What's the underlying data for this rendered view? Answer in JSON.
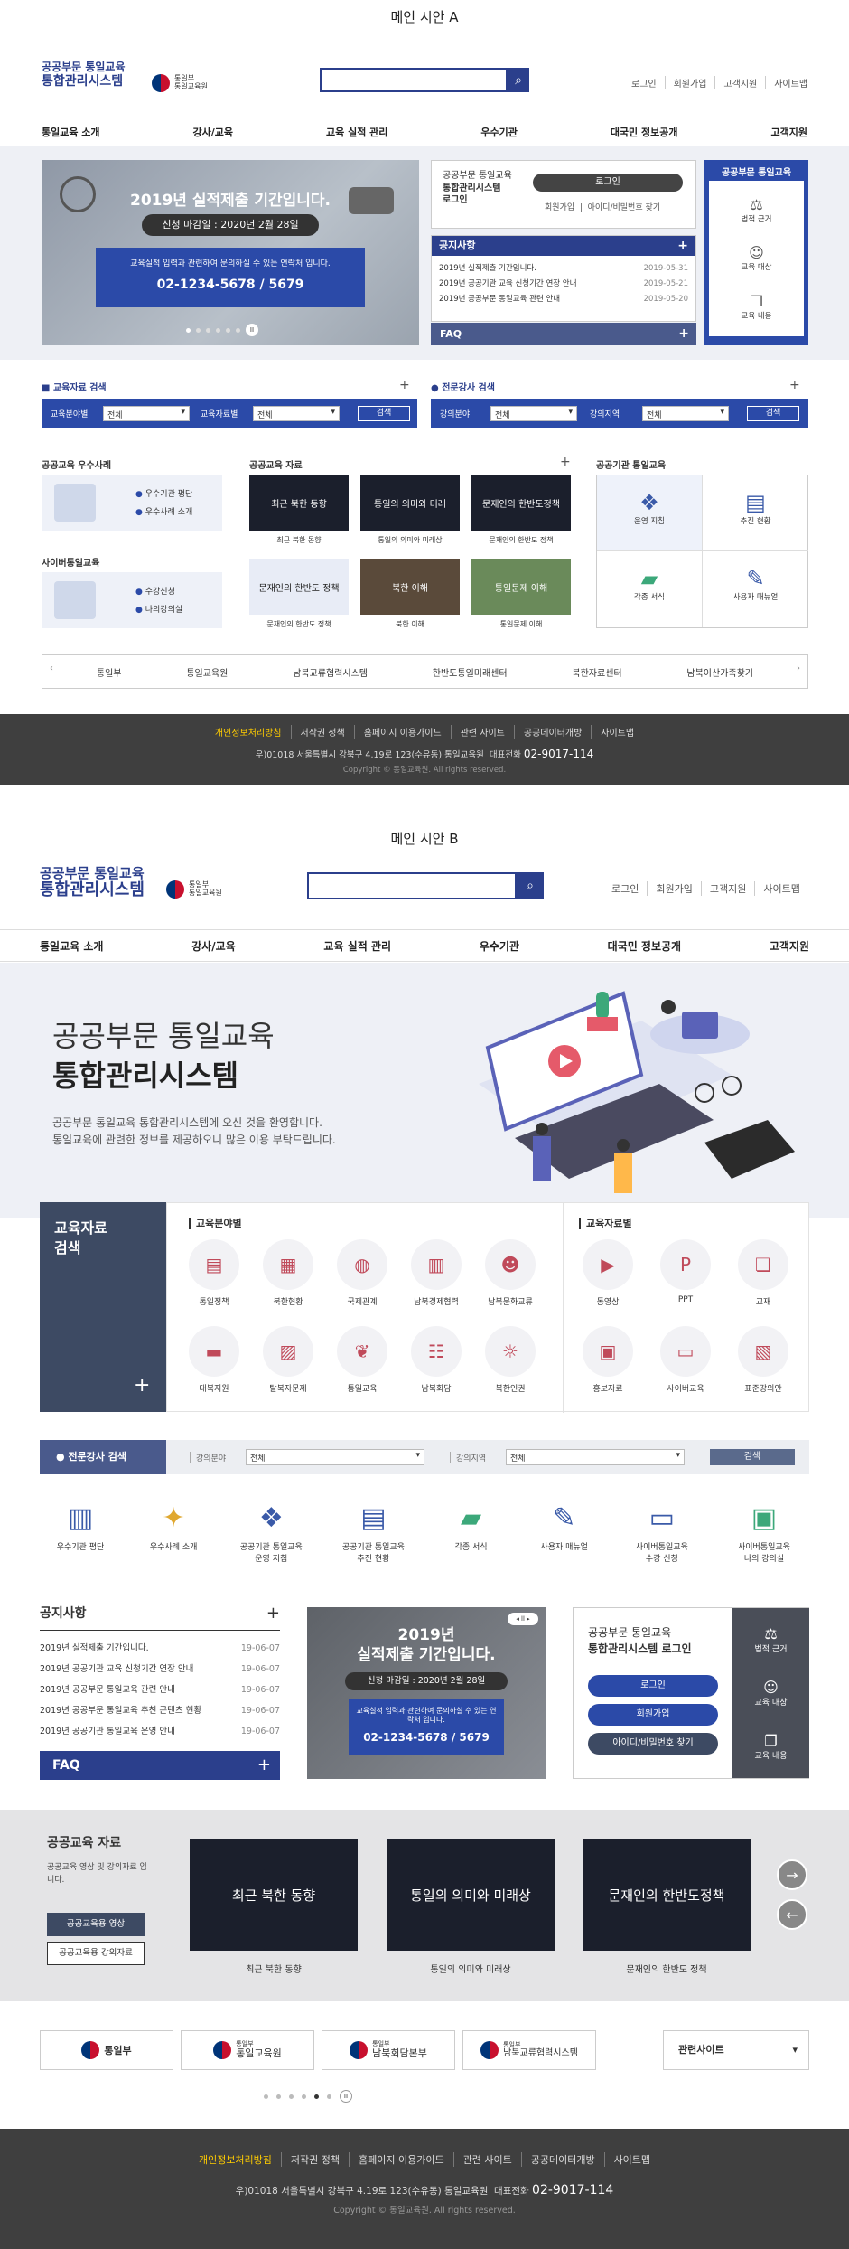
{
  "a": {
    "section_title": "메인 시안 A",
    "logo": {
      "line1": "공공부문 통일교육",
      "line2": "통합관리시스템"
    },
    "uni_logo": {
      "line1": "통일부",
      "line2": "통일교육원"
    },
    "util": [
      "로그인",
      "회원가입",
      "고객지원",
      "사이트맵"
    ],
    "gnb": [
      "통일교육 소개",
      "강사/교육",
      "교육 실적 관리",
      "우수기관",
      "대국민 정보공개",
      "고객지원"
    ],
    "hero": {
      "title": "2019년 실적제출 기간입니다.",
      "deadline": "신청 마감일 : 2020년 2월 28일",
      "notice": "교육실적 입력과 관련하여 문의하실 수 있는 연락처 입니다.",
      "phone": "02-1234-5678 / 5679"
    },
    "login": {
      "title1": "공공부문 통일교육",
      "title2": "통합관리시스템",
      "title3": "로그인",
      "login_btn": "로그인",
      "join": "회원가입",
      "find": "아이디/비밀번호 찾기"
    },
    "notice": {
      "title": "공지사항",
      "items": [
        {
          "text": "2019년 실적제출 기간입니다.",
          "date": "2019-05-31"
        },
        {
          "text": "2019년 공공기관 교육 신청기간 연장 안내",
          "date": "2019-05-21"
        },
        {
          "text": "2019년 공공부문 통일교육 관련 안내",
          "date": "2019-05-20"
        }
      ]
    },
    "faq": "FAQ",
    "side_panel": {
      "title": "공공부문 통일교육",
      "items": [
        "법적 근거",
        "교육 대상",
        "교육 내용"
      ]
    },
    "edu_search": {
      "title": "교육자료 검색",
      "label1": "교육분야별",
      "val1": "전체",
      "label2": "교육자료별",
      "val2": "전체",
      "btn": "검색"
    },
    "lecturer_search": {
      "title": "전문강사 검색",
      "label1": "강의분야",
      "val1": "전체",
      "label2": "강의지역",
      "val2": "전체",
      "btn": "검색"
    },
    "best": {
      "title": "공공교육 우수사례",
      "items": [
        "우수기관 평단",
        "우수사례 소개"
      ]
    },
    "cyber": {
      "title": "사이버통일교육",
      "items": [
        "수강신청",
        "나의강의실"
      ]
    },
    "materials": {
      "title": "공공교육 자료",
      "cards": [
        {
          "img": "최근 북한 동향",
          "cap": "최근 북한 동향"
        },
        {
          "img": "통일의 의미와 미래",
          "cap": "통일의 의미와 미래상"
        },
        {
          "img": "문재인의 한반도정책",
          "cap": "문재인의 한반도 정책"
        },
        {
          "img": "문재인의 한반도 정책",
          "cap": "문재인의 한반도 정책"
        },
        {
          "img": "북한 이해",
          "cap": "북한 이해"
        },
        {
          "img": "통일문제 이해",
          "cap": "통일문제 이해"
        }
      ]
    },
    "org": {
      "title": "공공기관 통일교육",
      "items": [
        "운영 지침",
        "추진 현황",
        "각종 서식",
        "사용자 매뉴얼"
      ]
    },
    "links": [
      "통일부",
      "통일교육원",
      "남북교류협력시스템",
      "한반도통일미래센터",
      "북한자료센터",
      "남북이산가족찾기"
    ],
    "footer": {
      "links": [
        "개인정보처리방침",
        "저작권 정책",
        "홈페이지 이용가이드",
        "관련 사이트",
        "공공데이터개방",
        "사이트맵"
      ],
      "address": "우)01018 서울특별시 강북구 4.19로 123(수유동) 통일교육원",
      "tel_label": "대표전화",
      "tel": "02-9017-114",
      "copy": "Copyright © 통일교육원. All rights reserved."
    }
  },
  "b": {
    "section_title": "메인 시안 B",
    "logo": {
      "line1": "공공부문 통일교육",
      "line2": "통합관리시스템"
    },
    "uni_logo": {
      "line1": "통일부",
      "line2": "통일교육원"
    },
    "util": [
      "로그인",
      "회원가입",
      "고객지원",
      "사이트맵"
    ],
    "gnb": [
      "통일교육 소개",
      "강사/교육",
      "교육 실적 관리",
      "우수기관",
      "대국민 정보공개",
      "고객지원"
    ],
    "hero": {
      "title1": "공공부문 통일교육",
      "title2": "통합관리시스템",
      "desc1": "공공부문 통일교육 통합관리시스템에 오신 것을 환영합니다.",
      "desc2": "통일교육에 관련한 정보를 제공하오니 많은 이용 부탁드립니다."
    },
    "edu_search": {
      "title": "교육자료\n검색",
      "by_field": "교육분야별",
      "by_type": "교육자료별",
      "fields": [
        "통일정책",
        "북한현황",
        "국제관계",
        "남북경제협력",
        "남북문화교류",
        "대북지원",
        "탈북자문제",
        "통일교육",
        "남북회담",
        "북한인권"
      ],
      "types": [
        "동영상",
        "PPT",
        "교재",
        "홍보자료",
        "사이버교육",
        "표준강의안"
      ]
    },
    "lecturer_search": {
      "title": "전문강사 검색",
      "label1": "강의분야",
      "val1": "전체",
      "label2": "강의지역",
      "val2": "전체",
      "btn": "검색"
    },
    "quick": [
      "우수기관 평단",
      "우수사례 소개",
      "공공기관 통일교육\n운영 지침",
      "공공기관 통일교육\n추진 현황",
      "각종 서식",
      "사용자 매뉴얼",
      "사이버통일교육\n수강 신청",
      "사이버통일교육\n나의 강의실"
    ],
    "notice": {
      "title": "공지사항",
      "items": [
        {
          "text": "2019년 실적제출 기간입니다.",
          "date": "19-06-07"
        },
        {
          "text": "2019년 공공기관 교육 신청기간 연장 안내",
          "date": "19-06-07"
        },
        {
          "text": "2019년 공공부문 통일교육 관련 안내",
          "date": "19-06-07"
        },
        {
          "text": "2019년 공공부문 통일교육 추천 콘텐츠 현황",
          "date": "19-06-07"
        },
        {
          "text": "2019년 공공기관 통일교육 운영 안내",
          "date": "19-06-07"
        }
      ]
    },
    "faq": "FAQ",
    "banner": {
      "title1": "2019년",
      "title2": "실적제출 기간입니다.",
      "deadline": "신청 마감일 : 2020년 2월 28일",
      "notice": "교육실적 입력과 관련하여 문의하실 수 있는 연락처 입니다.",
      "phone": "02-1234-5678 / 5679"
    },
    "login": {
      "title1": "공공부문 통일교육",
      "title2": "통합관리시스템 로그인",
      "login_btn": "로그인",
      "join_btn": "회원가입",
      "find_btn": "아이디/비밀번호 찾기",
      "side": [
        "법적 근거",
        "교육 대상",
        "교육 내용"
      ]
    },
    "materials": {
      "title": "공공교육 자료",
      "desc": "공공교육 영상 및 강의자료 입니다.",
      "btn1": "공공교육용 영상",
      "btn2": "공공교육용 강의자료",
      "cards": [
        {
          "img": "최근 북한 동향",
          "cap": "최근 북한 동향"
        },
        {
          "img": "통일의 의미와 미래상",
          "cap": "통일의 의미와 미래상"
        },
        {
          "img": "문재인의 한반도정책",
          "cap": "문재인의 한반도 정책"
        }
      ]
    },
    "partners": [
      {
        "sub": "",
        "name": "통일부"
      },
      {
        "sub": "통일부",
        "name": "통일교육원"
      },
      {
        "sub": "통일부",
        "name": "남북회담본부"
      },
      {
        "sub": "통일부",
        "name": "남북교류협력시스템"
      }
    ],
    "related": "관련사이트",
    "footer": {
      "links": [
        "개인정보처리방침",
        "저작권 정책",
        "홈페이지 이용가이드",
        "관련 사이트",
        "공공데이터개방",
        "사이트맵"
      ],
      "address": "우)01018 서울특별시 강북구 4.19로 123(수유동) 통일교육원",
      "tel_label": "대표전화",
      "tel": "02-9017-114",
      "copy": "Copyright © 통일교육원. All rights reserved."
    }
  },
  "colors": {
    "brand": "#2b3f8c",
    "accent": "#2b4aa8",
    "footer": "#3f3f3f",
    "highlight": "#ffcc00"
  }
}
